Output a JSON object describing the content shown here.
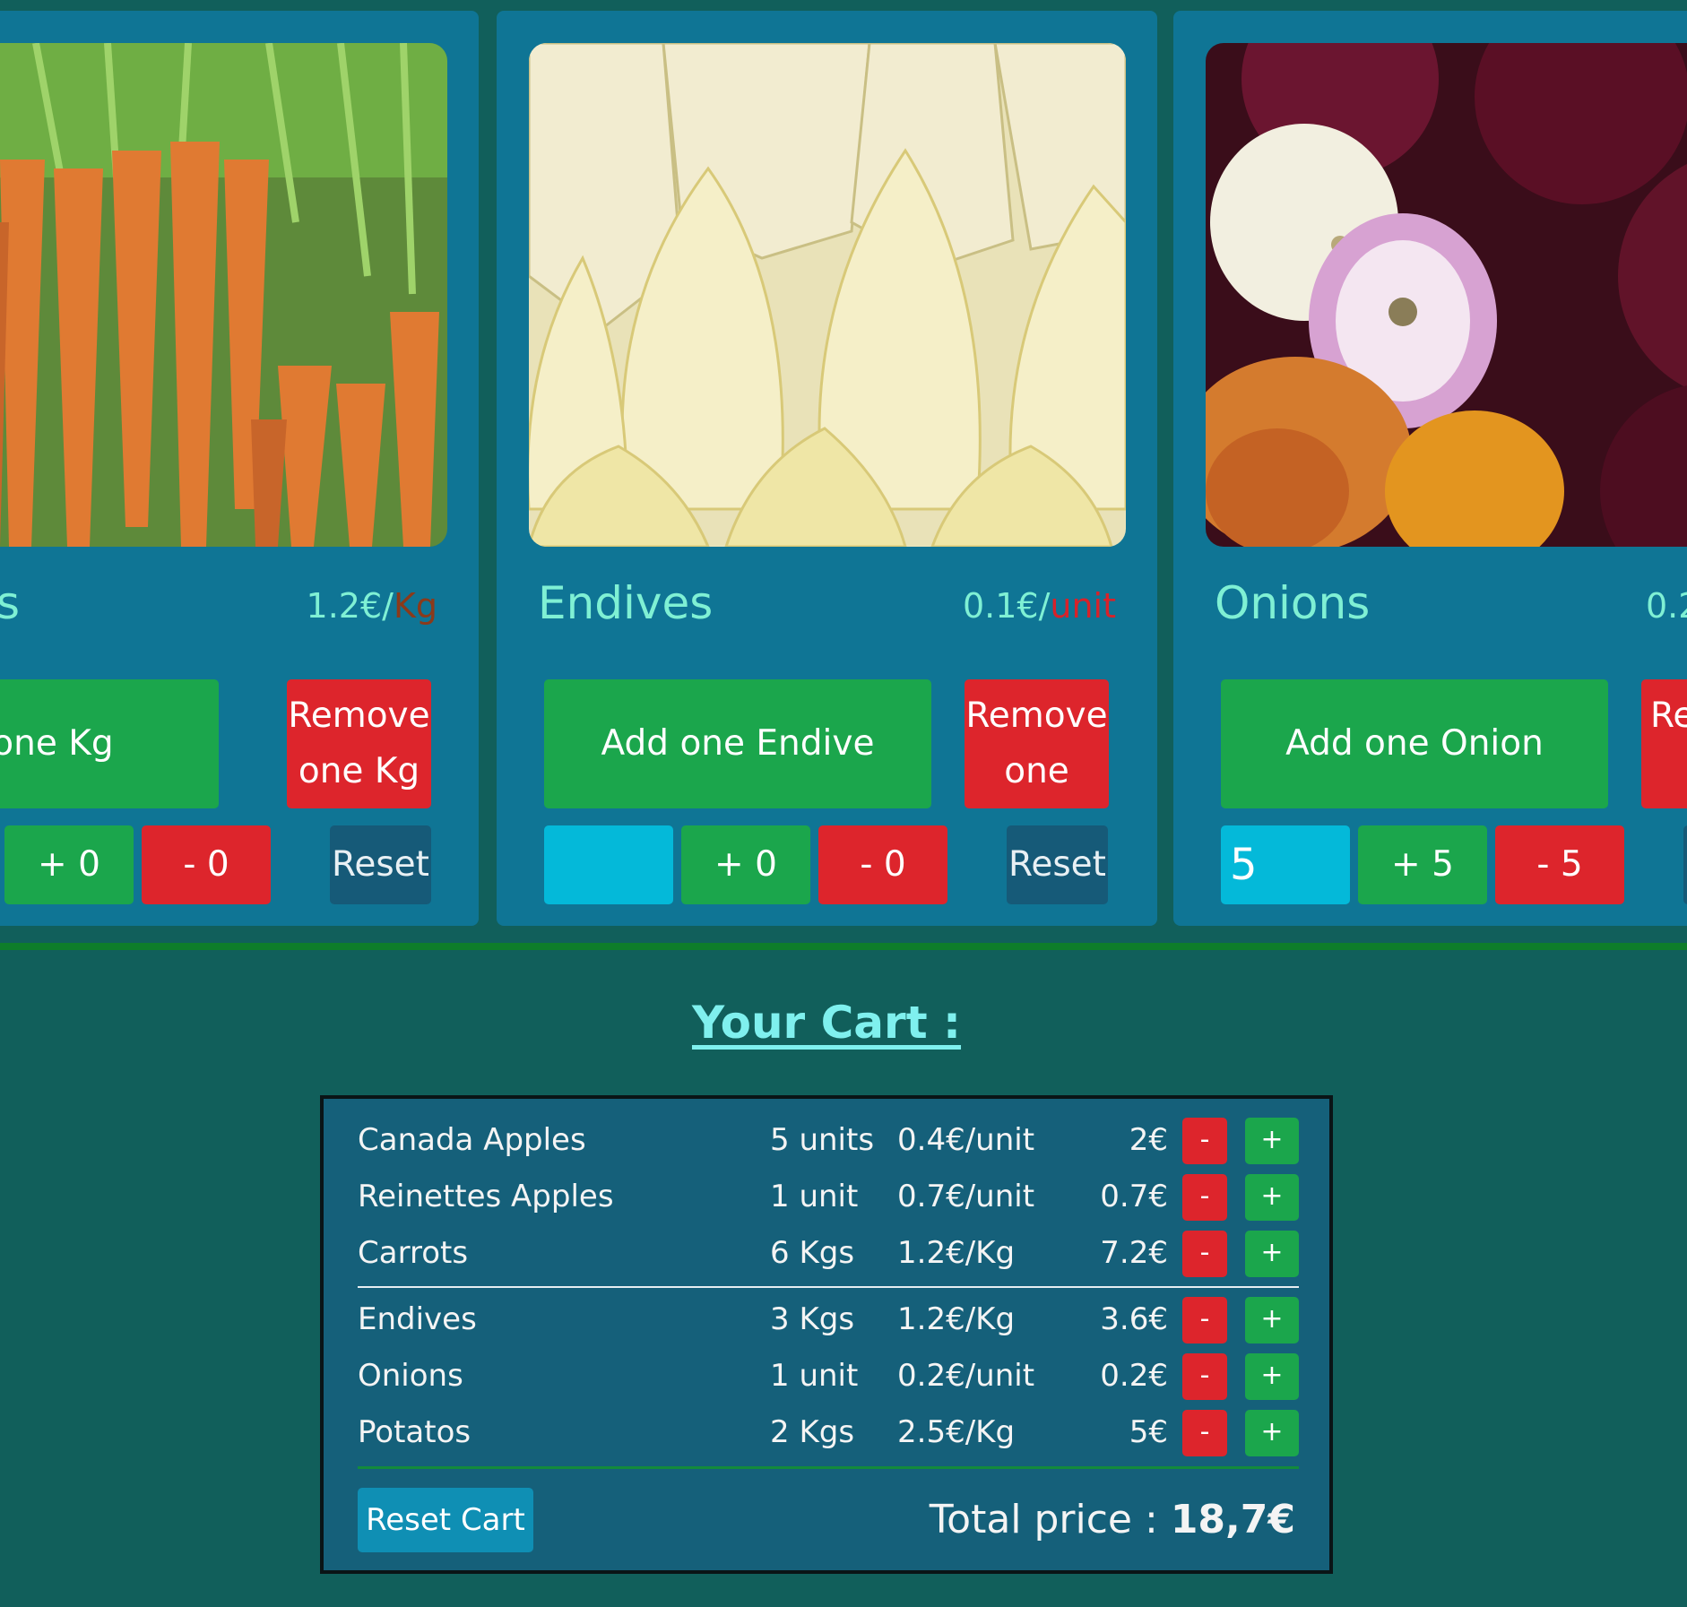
{
  "products": [
    {
      "name": "s",
      "price": "1.2€/",
      "price_unit": "Kg",
      "add_label": "dd one Kg",
      "remove_line1": "Remove",
      "remove_line2": "one Kg",
      "plus_label": "+ 0",
      "minus_label": "- 0",
      "reset_label": "Reset",
      "quantity_value": "",
      "image": "carrots"
    },
    {
      "name": "Endives",
      "price": "0.1€/",
      "price_unit": "unit",
      "add_label": "Add one Endive",
      "remove_line1": "Remove",
      "remove_line2": "one",
      "plus_label": "+ 0",
      "minus_label": "- 0",
      "reset_label": "Reset",
      "quantity_value": "",
      "image": "endives"
    },
    {
      "name": "Onions",
      "price": "0.2",
      "price_unit": "",
      "add_label": "Add one Onion",
      "remove_line1": "Re",
      "remove_line2": "",
      "plus_label": "+ 5",
      "minus_label": "- 5",
      "reset_label": "",
      "quantity_value": "5",
      "image": "onions"
    }
  ],
  "cart": {
    "title": "Your Cart :",
    "items": [
      {
        "name": "Canada Apples",
        "qty": "5 units",
        "unit_price": "0.4€/unit",
        "total": "2€"
      },
      {
        "name": "Reinettes Apples",
        "qty": "1 unit",
        "unit_price": "0.7€/unit",
        "total": "0.7€"
      },
      {
        "name": "Carrots",
        "qty": "6 Kgs",
        "unit_price": "1.2€/Kg",
        "total": "7.2€"
      },
      {
        "name": "Endives",
        "qty": "3 Kgs",
        "unit_price": "1.2€/Kg",
        "total": "3.6€"
      },
      {
        "name": "Onions",
        "qty": "1 unit",
        "unit_price": "0.2€/unit",
        "total": "0.2€"
      },
      {
        "name": "Potatos",
        "qty": "2 Kgs",
        "unit_price": "2.5€/Kg",
        "total": "5€"
      }
    ],
    "minus_label": "-",
    "plus_label": "+",
    "reset_label": "Reset Cart",
    "total_label": "Total price : ",
    "total_value": "18,7€"
  },
  "colors": {
    "page_bg": "#115f5b",
    "card_bg": "#0f7595",
    "green": "#1ba64c",
    "red": "#dd252c",
    "cyan": "#04b9d9",
    "accent_text": "#7ff0d4"
  }
}
